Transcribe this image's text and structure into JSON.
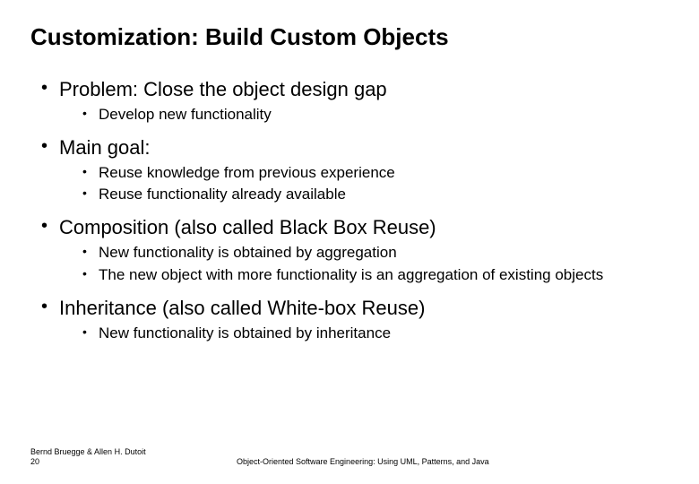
{
  "title": "Customization: Build Custom Objects",
  "bullets": [
    {
      "text": "Problem: Close the object design gap",
      "children": [
        {
          "text": "Develop new functionality"
        }
      ]
    },
    {
      "text": "Main goal:",
      "children": [
        {
          "text": "Reuse knowledge from previous experience"
        },
        {
          "text": "Reuse functionality already available"
        }
      ]
    },
    {
      "text": "Composition (also called Black Box Reuse)",
      "children": [
        {
          "text": "New functionality is obtained by aggregation"
        },
        {
          "text": "The new object with more functionality is an aggregation of existing objects"
        }
      ]
    },
    {
      "text": "Inheritance (also called White-box Reuse)",
      "children": [
        {
          "text": "New functionality is obtained by inheritance"
        }
      ]
    }
  ],
  "footer": {
    "authors": "Bernd Bruegge & Allen H. Dutoit",
    "page": "20",
    "book": "Object-Oriented Software Engineering: Using UML, Patterns, and Java"
  }
}
